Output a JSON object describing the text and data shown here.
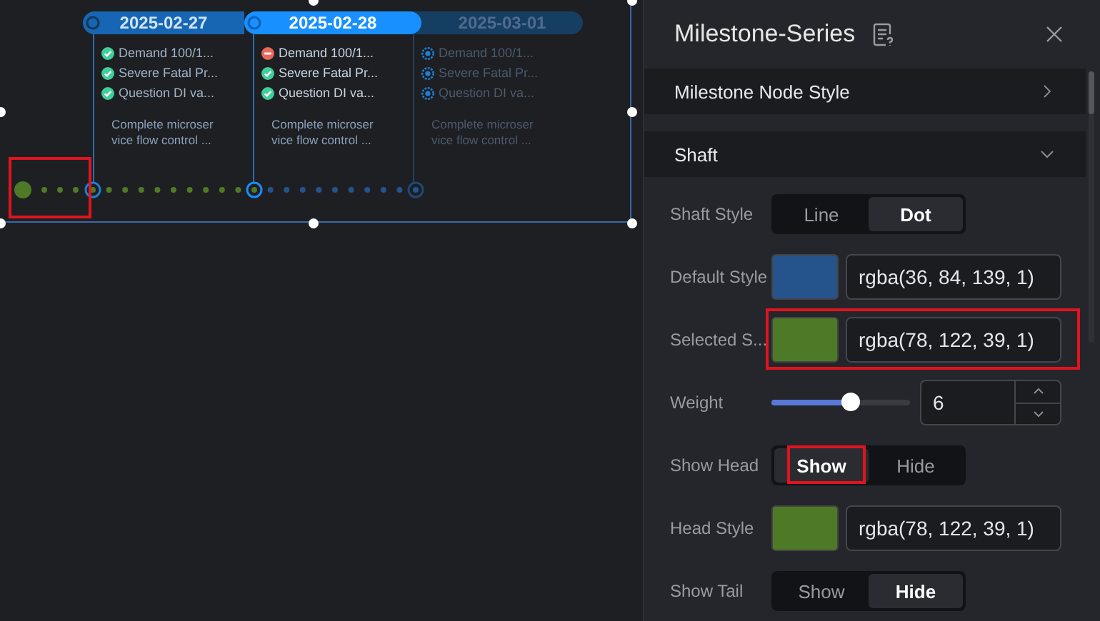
{
  "canvas": {
    "shaft": {
      "head_highlighted": true
    },
    "milestones": [
      {
        "date": "2025-02-27",
        "selected": false,
        "disabled": false,
        "tasks": [
          {
            "text": "Demand 100/1...",
            "kind": "done"
          },
          {
            "text": "Severe Fatal Pr...",
            "kind": "done"
          },
          {
            "text": "Question DI va...",
            "kind": "done"
          }
        ],
        "description": [
          "Complete microser",
          "vice flow control ..."
        ]
      },
      {
        "date": "2025-02-28",
        "selected": true,
        "disabled": false,
        "tasks": [
          {
            "text": "Demand 100/1...",
            "kind": "failed"
          },
          {
            "text": "Severe Fatal Pr...",
            "kind": "done"
          },
          {
            "text": "Question DI va...",
            "kind": "done"
          }
        ],
        "description": [
          "Complete microser",
          "vice flow control ..."
        ]
      },
      {
        "date": "2025-03-01",
        "selected": false,
        "disabled": true,
        "tasks": [
          {
            "text": "Demand 100/1...",
            "kind": "pending"
          },
          {
            "text": "Severe Fatal Pr...",
            "kind": "pending"
          },
          {
            "text": "Question DI va...",
            "kind": "pending"
          }
        ],
        "description": [
          "Complete microser",
          "vice flow control ..."
        ]
      }
    ]
  },
  "panel": {
    "title": "Milestone-Series",
    "sections": [
      {
        "title": "Milestone Node Style",
        "expanded": false
      },
      {
        "title": "Shaft",
        "expanded": true
      }
    ],
    "fields": [
      {
        "kind": "toggle",
        "label": "Shaft Style",
        "highlighted": false,
        "options": [
          {
            "label": "Line",
            "selected": false,
            "highlighted": false
          },
          {
            "label": "Dot",
            "selected": true,
            "highlighted": false
          }
        ]
      },
      {
        "kind": "color",
        "label": "Default Style",
        "highlighted": false,
        "color": "#24548b",
        "value": "rgba(36, 84, 139, 1)"
      },
      {
        "kind": "color",
        "label": "Selected S...",
        "highlighted": true,
        "color": "#4e7a27",
        "value": "rgba(78, 122, 39, 1)"
      },
      {
        "kind": "slider",
        "label": "Weight",
        "highlighted": false,
        "level": 0.57,
        "value": "6"
      },
      {
        "kind": "toggle",
        "label": "Show Head",
        "highlighted": false,
        "options": [
          {
            "label": "Show",
            "selected": true,
            "highlighted": true
          },
          {
            "label": "Hide",
            "selected": false,
            "highlighted": false
          }
        ]
      },
      {
        "kind": "color",
        "label": "Head Style",
        "highlighted": false,
        "color": "#4e7a27",
        "value": "rgba(78, 122, 39, 1)"
      },
      {
        "kind": "toggle",
        "label": "Show Tail",
        "highlighted": false,
        "options": [
          {
            "label": "Show",
            "selected": false,
            "highlighted": false
          },
          {
            "label": "Hide",
            "selected": true,
            "highlighted": false
          }
        ]
      }
    ]
  }
}
